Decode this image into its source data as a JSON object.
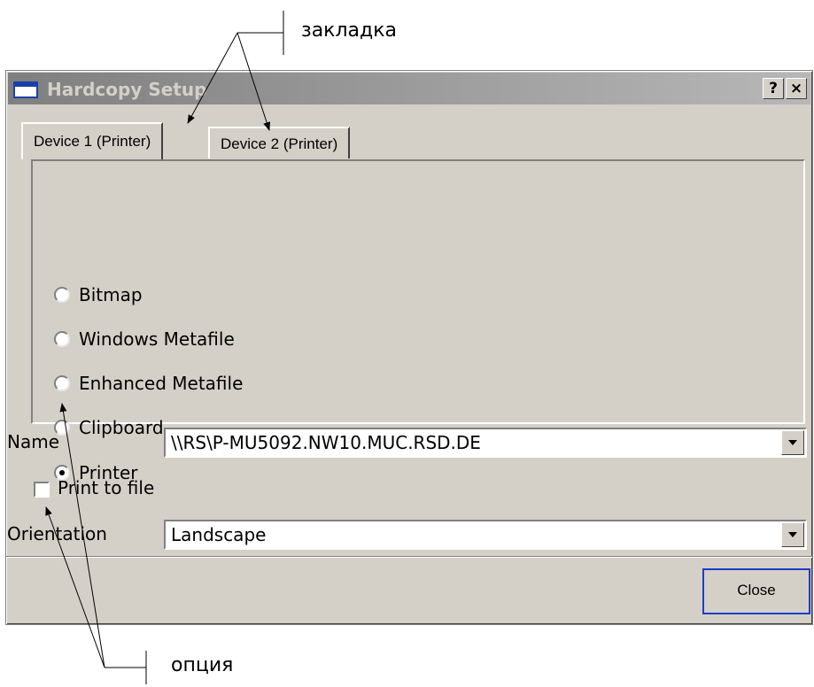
{
  "annotations": {
    "tab_callout": "закладка",
    "option_callout": "опция"
  },
  "window": {
    "title": "Hardcopy Setup",
    "help_button": "?",
    "close_button": "×"
  },
  "tabs": [
    {
      "label": "Device 1 (Printer)",
      "active": true
    },
    {
      "label": "Device 2 (Printer)",
      "active": false
    }
  ],
  "output_options": [
    {
      "label": "Bitmap",
      "selected": false
    },
    {
      "label": "Windows Metafile",
      "selected": false
    },
    {
      "label": "Enhanced Metafile",
      "selected": false
    },
    {
      "label": "Clipboard",
      "selected": false
    },
    {
      "label": "Printer",
      "selected": true
    }
  ],
  "name_field": {
    "label": "Name",
    "value": "\\\\RS\\P-MU5092.NW10.MUC.RSD.DE"
  },
  "print_to_file": {
    "label": "Print to file",
    "checked": false
  },
  "orientation_field": {
    "label": "Orientation",
    "value": "Landscape"
  },
  "buttons": {
    "close": "Close"
  },
  "colors": {
    "dialog_bg": "#d4d0c8",
    "titlebar_inactive": "#808080",
    "focus_border": "#1e3cc8"
  }
}
